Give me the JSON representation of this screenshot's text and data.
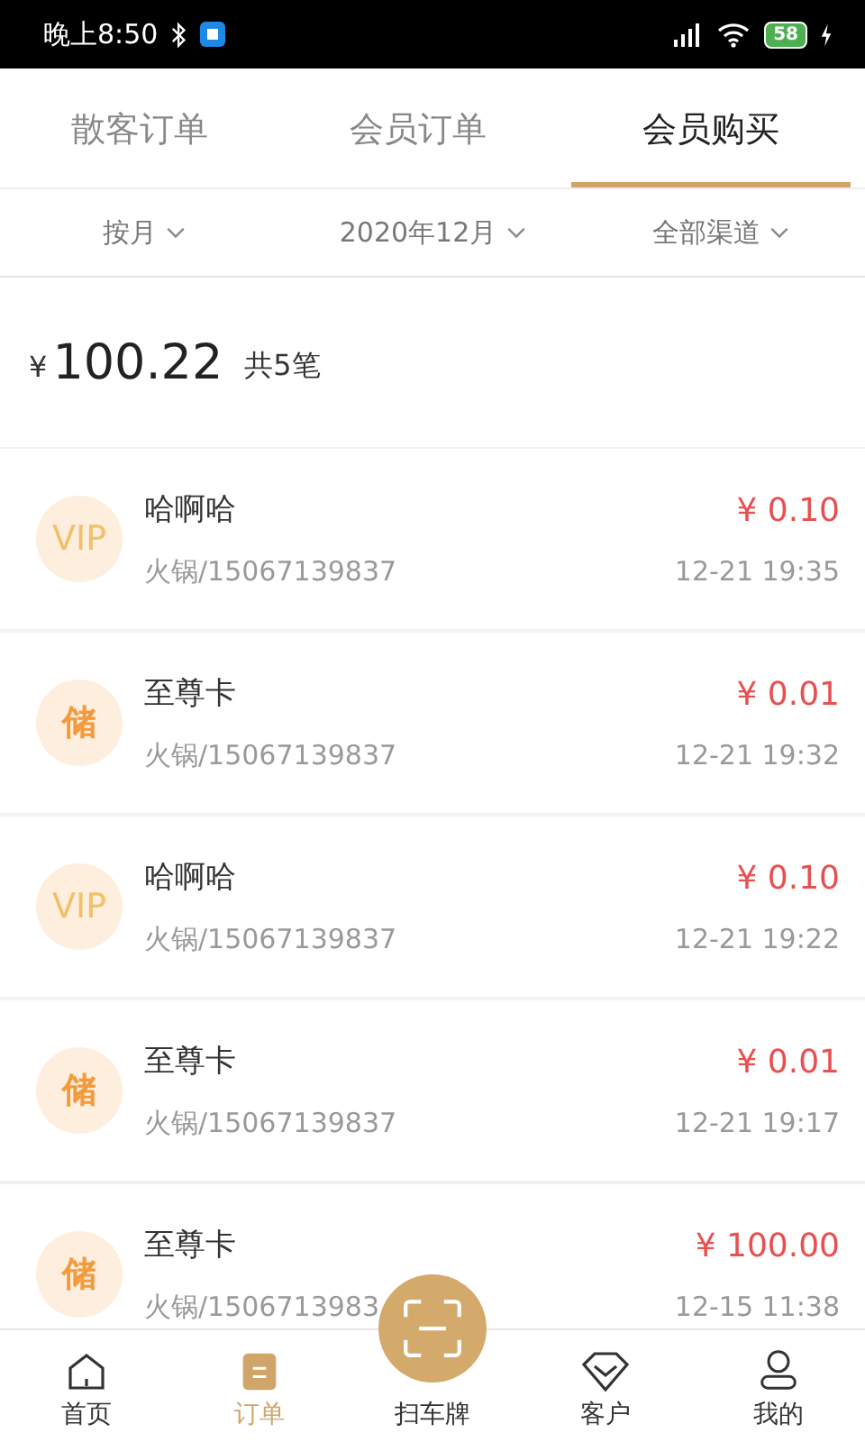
{
  "status_bar": {
    "time": "晚上8:50",
    "battery": "58"
  },
  "tabs": [
    {
      "label": "散客订单",
      "selected": false
    },
    {
      "label": "会员订单",
      "selected": false
    },
    {
      "label": "会员购买",
      "selected": true
    }
  ],
  "filters": [
    "按月",
    "2020年12月",
    "全部渠道"
  ],
  "summary": {
    "currency": "¥",
    "total": "100.22",
    "count": "共5笔"
  },
  "orders": [
    {
      "kind": "vip",
      "badge": "VIP",
      "name": "哈啊哈",
      "detail": "火锅/15067139837",
      "amount": "¥ 0.10",
      "time": "12-21 19:35"
    },
    {
      "kind": "stored",
      "badge": "储",
      "name": "至尊卡",
      "detail": "火锅/15067139837",
      "amount": "¥ 0.01",
      "time": "12-21 19:32"
    },
    {
      "kind": "vip",
      "badge": "VIP",
      "name": "哈啊哈",
      "detail": "火锅/15067139837",
      "amount": "¥ 0.10",
      "time": "12-21 19:22"
    },
    {
      "kind": "stored",
      "badge": "储",
      "name": "至尊卡",
      "detail": "火锅/15067139837",
      "amount": "¥ 0.01",
      "time": "12-21 19:17"
    },
    {
      "kind": "stored",
      "badge": "储",
      "name": "至尊卡",
      "detail": "火锅/1506713983",
      "amount": "¥ 100.00",
      "time": "12-15 11:38"
    }
  ],
  "nav": [
    {
      "kind": "home",
      "label": "首页",
      "selected": false
    },
    {
      "kind": "orders",
      "label": "订单",
      "selected": true
    },
    {
      "kind": "scan",
      "label": "扫车牌",
      "selected": false
    },
    {
      "kind": "customers",
      "label": "客户",
      "selected": false
    },
    {
      "kind": "me",
      "label": "我的",
      "selected": false
    }
  ]
}
